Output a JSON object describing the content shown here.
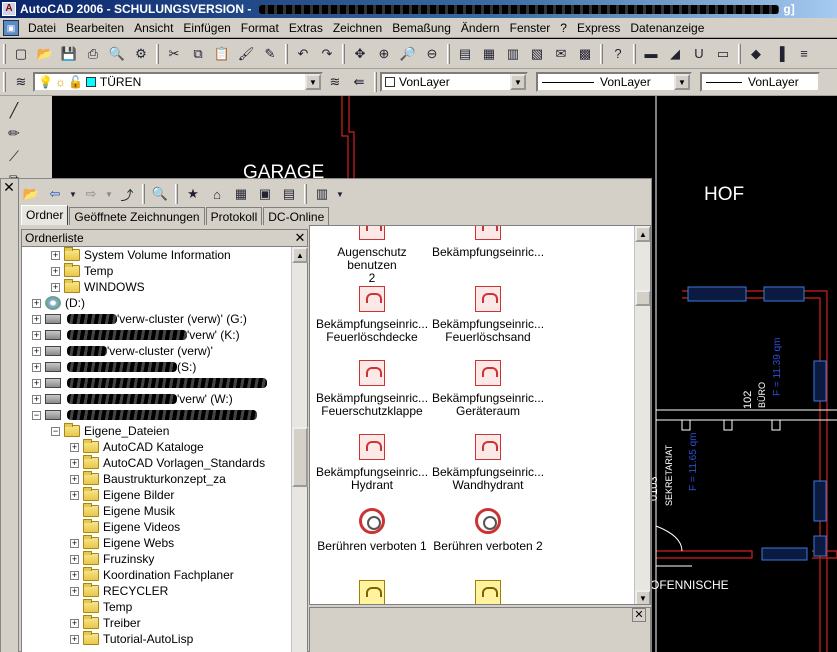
{
  "title": {
    "text": "AutoCAD 2006 - SCHULUNGSVERSION - ",
    "end": "g]"
  },
  "menu": [
    "Datei",
    "Bearbeiten",
    "Ansicht",
    "Einfügen",
    "Format",
    "Extras",
    "Zeichnen",
    "Bemaßung",
    "Ändern",
    "Fenster",
    "?",
    "Express",
    "Datenanzeige"
  ],
  "layer": {
    "name": "TÜREN",
    "color": "#00ffff"
  },
  "props": {
    "color": "VonLayer",
    "linetype": "VonLayer",
    "lineweight": "VonLayer"
  },
  "drawing": {
    "labels": [
      "GARAGE",
      "HOF",
      "OFENNISCHE",
      "0103",
      "SEKRETARIAT",
      "102",
      "BÜRO"
    ],
    "areas": [
      "F = 11.65 qm",
      "F = 11.39 qm"
    ]
  },
  "dc": {
    "tabs": [
      "Ordner",
      "Geöffnete Zeichnungen",
      "Protokoll",
      "DC-Online"
    ],
    "tree_header": "Ordnerliste",
    "tree": [
      {
        "label": "System Volume Information",
        "indent": 2,
        "type": "folder",
        "pm": "+"
      },
      {
        "label": "Temp",
        "indent": 2,
        "type": "folder",
        "pm": "+"
      },
      {
        "label": "WINDOWS",
        "indent": 2,
        "type": "folder",
        "pm": "+"
      },
      {
        "label": "(D:)",
        "indent": 1,
        "type": "cd",
        "pm": "+"
      },
      {
        "label": "'verw-cluster (verw)' (G:)",
        "indent": 1,
        "type": "drive",
        "pm": "+",
        "scrib": 50
      },
      {
        "label": "'verw' (K:)",
        "indent": 1,
        "type": "drive",
        "pm": "+",
        "scrib": 120
      },
      {
        "label": "'verw-cluster (verw)'",
        "indent": 1,
        "type": "drive",
        "pm": "+",
        "scrib": 40
      },
      {
        "label": "(S:)",
        "indent": 1,
        "type": "drive",
        "pm": "+",
        "scrib": 110
      },
      {
        "label": "",
        "indent": 1,
        "type": "drive",
        "pm": "+",
        "scrib": 200
      },
      {
        "label": "'verw' (W:)",
        "indent": 1,
        "type": "drive",
        "pm": "+",
        "scrib": 110
      },
      {
        "label": "",
        "indent": 1,
        "type": "drive",
        "pm": "-",
        "scrib": 190
      },
      {
        "label": "Eigene_Dateien",
        "indent": 2,
        "type": "folder",
        "pm": "-"
      },
      {
        "label": "AutoCAD Kataloge",
        "indent": 3,
        "type": "folder",
        "pm": "+"
      },
      {
        "label": "AutoCAD Vorlagen_Standards",
        "indent": 3,
        "type": "folder",
        "pm": "+"
      },
      {
        "label": "Baustrukturkonzept_za",
        "indent": 3,
        "type": "folder",
        "pm": "+"
      },
      {
        "label": "Eigene Bilder",
        "indent": 3,
        "type": "folder",
        "pm": "+"
      },
      {
        "label": "Eigene Musik",
        "indent": 3,
        "type": "folder",
        "pm": ""
      },
      {
        "label": "Eigene Videos",
        "indent": 3,
        "type": "folder",
        "pm": ""
      },
      {
        "label": "Eigene Webs",
        "indent": 3,
        "type": "folder",
        "pm": "+"
      },
      {
        "label": "Fruzinsky",
        "indent": 3,
        "type": "folder",
        "pm": "+"
      },
      {
        "label": "Koordination Fachplaner",
        "indent": 3,
        "type": "folder",
        "pm": "+"
      },
      {
        "label": "RECYCLER",
        "indent": 3,
        "type": "folder",
        "pm": "+"
      },
      {
        "label": "Temp",
        "indent": 3,
        "type": "folder",
        "pm": ""
      },
      {
        "label": "Treiber",
        "indent": 3,
        "type": "folder",
        "pm": "+"
      },
      {
        "label": "Tutorial-AutoLisp",
        "indent": 3,
        "type": "folder",
        "pm": "+"
      }
    ],
    "icons": [
      {
        "line1": "Augenschutz benutzen",
        "line2": "2",
        "style": "sign"
      },
      {
        "line1": "Bekämpfungseinric...",
        "line2": "",
        "style": "sign"
      },
      {
        "line1": "Bekämpfungseinric...",
        "line2": "Feuerlöschdecke",
        "style": "sign"
      },
      {
        "line1": "Bekämpfungseinric...",
        "line2": "Feuerlöschsand",
        "style": "sign"
      },
      {
        "line1": "Bekämpfungseinric...",
        "line2": "Feuerschutzklappe",
        "style": "sign"
      },
      {
        "line1": "Bekämpfungseinric...",
        "line2": "Geräteraum",
        "style": "sign"
      },
      {
        "line1": "Bekämpfungseinric...",
        "line2": "Hydrant",
        "style": "sign"
      },
      {
        "line1": "Bekämpfungseinric...",
        "line2": "Wandhydrant",
        "style": "sign"
      },
      {
        "line1": "Berühren verboten 1",
        "line2": "",
        "style": "round"
      },
      {
        "line1": "Berühren verboten 2",
        "line2": "",
        "style": "round"
      },
      {
        "line1": "",
        "line2": "",
        "style": "yellow"
      },
      {
        "line1": "",
        "line2": "",
        "style": "yellow"
      }
    ]
  }
}
